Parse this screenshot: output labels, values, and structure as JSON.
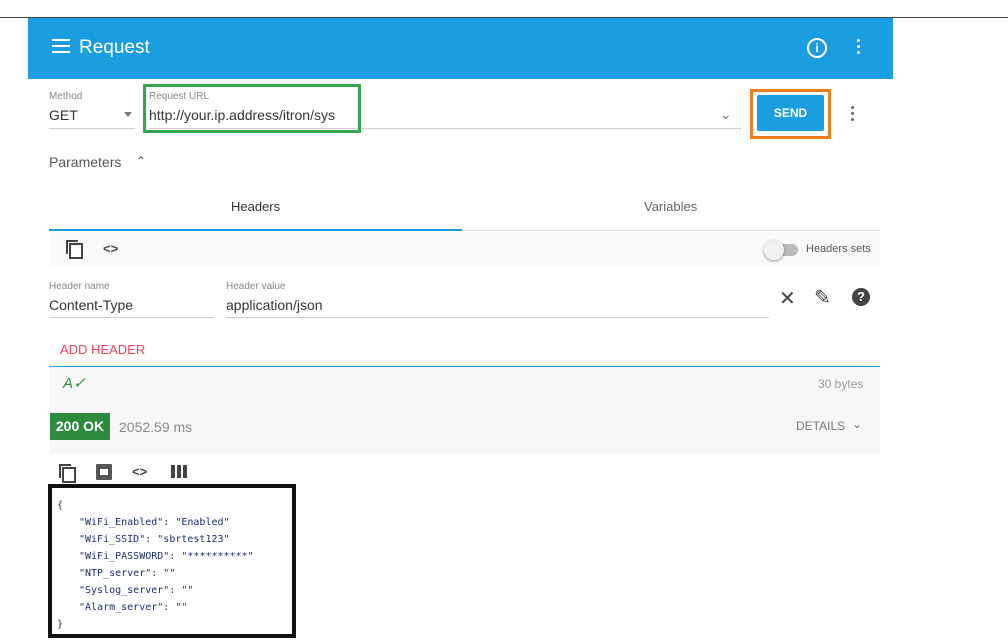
{
  "app": {
    "title": "Request"
  },
  "request": {
    "method_label": "Method",
    "method": "GET",
    "url_label": "Request URL",
    "url": "http://your.ip.address/itron/sys",
    "send_label": "SEND"
  },
  "parameters": {
    "label": "Parameters",
    "tabs": [
      {
        "label": "Headers"
      },
      {
        "label": "Variables"
      }
    ],
    "headers_sets_label": "Headers sets",
    "header_name_label": "Header name",
    "header_name": "Content-Type",
    "header_value_label": "Header value",
    "header_value": "application/json",
    "add_header_label": "ADD HEADER",
    "size": "30 bytes"
  },
  "response": {
    "status": "200 OK",
    "time": "2052.59 ms",
    "details_label": "DETAILS",
    "open_brace": "{",
    "close_brace": "}",
    "body": [
      {
        "key": "\"WiFi_Enabled\"",
        "value": "\"Enabled\""
      },
      {
        "key": "\"WiFi_SSID\"",
        "value": "\"sbrtest123\""
      },
      {
        "key": "\"WiFi_PASSWORD\"",
        "value": "\"**********\""
      },
      {
        "key": "\"NTP_server\"",
        "value": "\"\""
      },
      {
        "key": "\"Syslog_server\"",
        "value": "\"\""
      },
      {
        "key": "\"Alarm_server\"",
        "value": "\"\""
      }
    ]
  },
  "colors": {
    "primary": "#1a9de1",
    "status_ok": "#2e8b3e",
    "add_header": "#e8445a",
    "url_highlight": "#2fa84f",
    "send_highlight": "#f07d1c"
  }
}
